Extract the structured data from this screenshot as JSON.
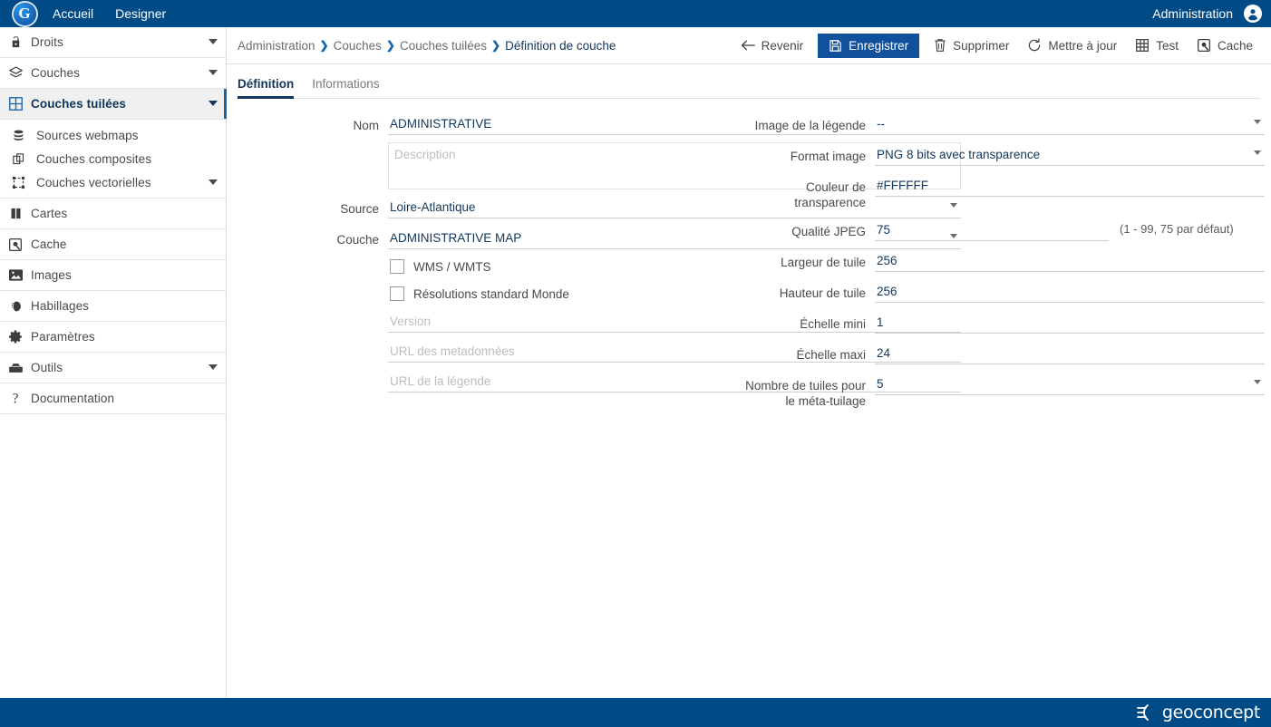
{
  "header": {
    "logo_icon": "geoconcept-g-logo",
    "nav": [
      {
        "label": "Accueil",
        "icon": "home-nav-item"
      },
      {
        "label": "Designer",
        "icon": "designer-nav-item"
      }
    ],
    "right_label": "Administration",
    "avatar_icon": "user-account-icon",
    "bg_color": "#004B85"
  },
  "sidebar": {
    "items": [
      {
        "label": "Droits",
        "icon": "lock-icon",
        "caret": true,
        "active": false,
        "sub": false
      },
      {
        "label": "Couches",
        "icon": "layers-icon",
        "caret": true,
        "active": false,
        "sub": false
      },
      {
        "label": "Couches tuilées",
        "icon": "grid-tiles-icon",
        "caret": true,
        "active": true,
        "sub": false
      },
      {
        "label": "Sources webmaps",
        "icon": "database-stack-icon",
        "caret": false,
        "active": false,
        "sub": true
      },
      {
        "label": "Couches composites",
        "icon": "composite-layers-icon",
        "caret": false,
        "active": false,
        "sub": true
      },
      {
        "label": "Couches vectorielles",
        "icon": "vector-layers-icon",
        "caret": true,
        "active": false,
        "sub": true
      },
      {
        "label": "Cartes",
        "icon": "map-icon",
        "caret": false,
        "active": false,
        "sub": false
      },
      {
        "label": "Cache",
        "icon": "disk-cache-icon",
        "caret": false,
        "active": false,
        "sub": false
      },
      {
        "label": "Images",
        "icon": "image-icon",
        "caret": false,
        "active": false,
        "sub": false
      },
      {
        "label": "Habillages",
        "icon": "styles-icon",
        "caret": false,
        "active": false,
        "sub": false
      },
      {
        "label": "Paramètres",
        "icon": "gear-icon",
        "caret": false,
        "active": false,
        "sub": false
      },
      {
        "label": "Outils",
        "icon": "toolbox-icon",
        "caret": true,
        "active": false,
        "sub": false
      },
      {
        "label": "Documentation",
        "icon": "question-mark-icon",
        "caret": false,
        "active": false,
        "sub": false
      }
    ]
  },
  "breadcrumb": {
    "items": [
      "Administration",
      "Couches",
      "Couches tuilées",
      "Définition de couche"
    ],
    "separator": "❯"
  },
  "toolbar": {
    "buttons": [
      {
        "label": "Revenir",
        "icon": "arrow-left-icon",
        "primary": false
      },
      {
        "label": "Enregistrer",
        "icon": "save-floppy-icon",
        "primary": true
      },
      {
        "label": "Supprimer",
        "icon": "trash-icon",
        "primary": false
      },
      {
        "label": "Mettre à jour",
        "icon": "refresh-icon",
        "primary": false
      },
      {
        "label": "Test",
        "icon": "grid-tiles-icon",
        "primary": false
      },
      {
        "label": "Cache",
        "icon": "disk-cache-icon",
        "primary": false
      }
    ],
    "primary_color": "#11519b"
  },
  "tabs": [
    {
      "label": "Définition",
      "active": true
    },
    {
      "label": "Informations",
      "active": false
    }
  ],
  "form": {
    "left": {
      "nom": {
        "label": "Nom",
        "value": "ADMINISTRATIVE"
      },
      "description": {
        "label": "",
        "value": "",
        "placeholder": "Description"
      },
      "source": {
        "label": "Source",
        "value": "Loire-Atlantique"
      },
      "couche": {
        "label": "Couche",
        "value": "ADMINISTRATIVE MAP"
      },
      "wms_wmts": {
        "label": "WMS / WMTS",
        "checked": false
      },
      "resolutions": {
        "label": "Résolutions standard Monde",
        "checked": false
      },
      "version": {
        "value": "",
        "placeholder": "Version"
      },
      "url_metadonnees": {
        "value": "",
        "placeholder": "URL des metadonnées"
      },
      "url_legende": {
        "value": "",
        "placeholder": "URL de la légende"
      }
    },
    "right": {
      "image_legende": {
        "label": "Image de la légende",
        "value": "--"
      },
      "format_image": {
        "label": "Format image",
        "value": "PNG 8 bits avec transparence"
      },
      "couleur_transparence": {
        "label": "Couleur de transparence",
        "value": "#FFFFFF"
      },
      "qualite_jpeg": {
        "label": "Qualité JPEG",
        "value": "75",
        "hint": "(1 - 99, 75 par défaut)"
      },
      "largeur_tuile": {
        "label": "Largeur de tuile",
        "value": "256"
      },
      "hauteur_tuile": {
        "label": "Hauteur de tuile",
        "value": "256"
      },
      "echelle_mini": {
        "label": "Échelle mini",
        "value": "1"
      },
      "echelle_maxi": {
        "label": "Échelle maxi",
        "value": "24"
      },
      "nb_tuiles_meta": {
        "label": "Nombre de tuiles pour le méta-tuilage",
        "value": "5"
      }
    }
  },
  "footer": {
    "brand": "geoconcept",
    "bg_color": "#004B85"
  }
}
